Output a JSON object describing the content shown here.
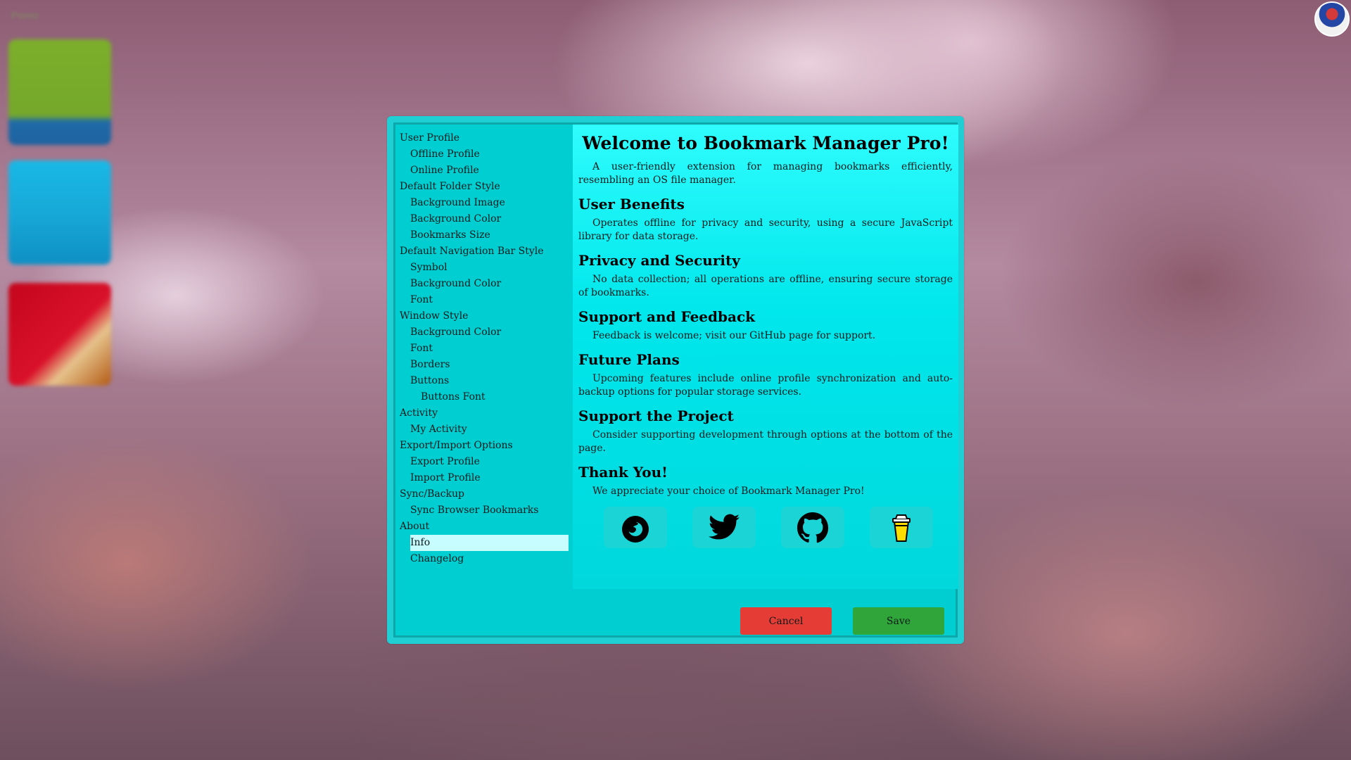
{
  "desktop": {
    "corner_label": "Pomo"
  },
  "sidebar": {
    "items": [
      {
        "label": "User Profile",
        "level": 0
      },
      {
        "label": "Offline Profile",
        "level": 1
      },
      {
        "label": "Online Profile",
        "level": 1
      },
      {
        "label": "Default Folder Style",
        "level": 0
      },
      {
        "label": "Background Image",
        "level": 1
      },
      {
        "label": "Background Color",
        "level": 1
      },
      {
        "label": "Bookmarks Size",
        "level": 1
      },
      {
        "label": "Default Navigation Bar Style",
        "level": 0
      },
      {
        "label": "Symbol",
        "level": 1
      },
      {
        "label": "Background Color",
        "level": 1
      },
      {
        "label": "Font",
        "level": 1
      },
      {
        "label": "Window Style",
        "level": 0
      },
      {
        "label": "Background Color",
        "level": 1
      },
      {
        "label": "Font",
        "level": 1
      },
      {
        "label": "Borders",
        "level": 1
      },
      {
        "label": "Buttons",
        "level": 1
      },
      {
        "label": "Buttons Font",
        "level": 2
      },
      {
        "label": "Activity",
        "level": 0
      },
      {
        "label": "My Activity",
        "level": 1
      },
      {
        "label": "Export/Import Options",
        "level": 0
      },
      {
        "label": "Export Profile",
        "level": 1
      },
      {
        "label": "Import Profile",
        "level": 1
      },
      {
        "label": "Sync/Backup",
        "level": 0
      },
      {
        "label": "Sync Browser Bookmarks",
        "level": 1
      },
      {
        "label": "About",
        "level": 0
      },
      {
        "label": "Info",
        "level": 1,
        "selected": true
      },
      {
        "label": "Changelog",
        "level": 1
      }
    ]
  },
  "content": {
    "title": "Welcome to Bookmark Manager Pro!",
    "intro": "A user-friendly extension for managing bookmarks efficiently, resembling an OS file manager.",
    "sections": [
      {
        "heading": "User Benefits",
        "text": "Operates offline for privacy and security, using a secure JavaScript library for data storage."
      },
      {
        "heading": "Privacy and Security",
        "text": "No data collection; all operations are offline, ensuring secure storage of bookmarks."
      },
      {
        "heading": "Support and Feedback",
        "text": "Feedback is welcome; visit our GitHub page for support."
      },
      {
        "heading": "Future Plans",
        "text": "Upcoming features include online profile synchronization and auto-backup options for popular storage services."
      },
      {
        "heading": "Support the Project",
        "text": "Consider supporting development through options at the bottom of the page."
      },
      {
        "heading": "Thank You!",
        "text": "We appreciate your choice of Bookmark Manager Pro!"
      }
    ],
    "links": [
      {
        "icon": "firefox-icon"
      },
      {
        "icon": "twitter-icon"
      },
      {
        "icon": "github-icon"
      },
      {
        "icon": "coffee-cup-icon"
      }
    ]
  },
  "footer": {
    "cancel_label": "Cancel",
    "save_label": "Save"
  },
  "colors": {
    "dialog_border": "#20cfd4",
    "dialog_bg": "#00ced1",
    "selected_bg": "#c8fdff",
    "cancel_bg": "#e63c36",
    "save_bg": "#2fa53a"
  }
}
